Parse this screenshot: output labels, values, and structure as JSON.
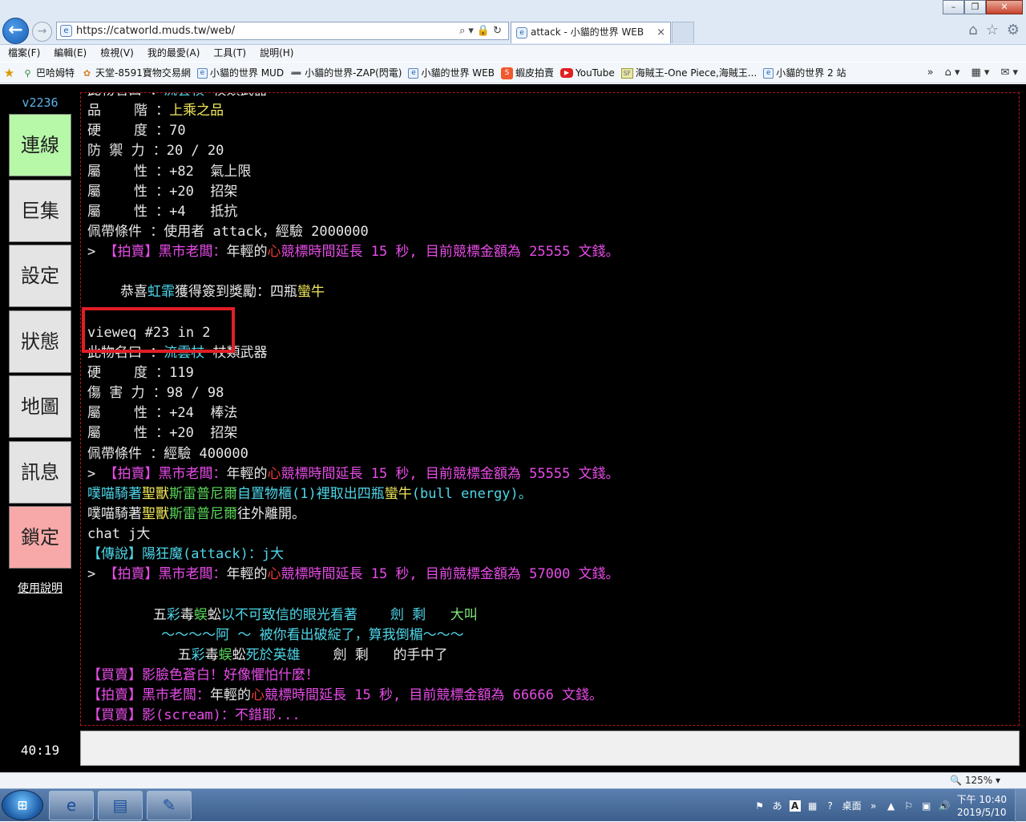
{
  "browser": {
    "url": "https://catworld.muds.tw/web/",
    "tab_title": "attack - 小貓的世界 WEB",
    "tab_close": "×",
    "menu": [
      "檔案(F)",
      "編輯(E)",
      "檢視(V)",
      "我的最愛(A)",
      "工具(T)",
      "說明(H)"
    ],
    "favorites": [
      {
        "label": "巴哈姆特",
        "icon": "bird-icon"
      },
      {
        "label": "天堂-8591寶物交易網",
        "icon": "gift-icon"
      },
      {
        "label": "小貓的世界 MUD",
        "icon": "page-icon"
      },
      {
        "label": "小貓的世界-ZAP(閃電)",
        "icon": "zap-icon"
      },
      {
        "label": "小貓的世界 WEB",
        "icon": "page-icon"
      },
      {
        "label": "蝦皮拍賣",
        "icon": "shopee-icon"
      },
      {
        "label": "YouTube",
        "icon": "youtube-icon"
      },
      {
        "label": "海賊王-One Piece,海賊王...",
        "icon": "sf-icon"
      },
      {
        "label": "小貓的世界 2 站",
        "icon": "page-icon"
      }
    ],
    "zoom": "125%"
  },
  "sidebar": {
    "version": "v2236",
    "buttons": [
      {
        "label": "連線",
        "style": "green"
      },
      {
        "label": "巨集",
        "style": "gray"
      },
      {
        "label": "設定",
        "style": "gray"
      },
      {
        "label": "狀態",
        "style": "gray"
      },
      {
        "label": "地圖",
        "style": "gray"
      },
      {
        "label": "訊息",
        "style": "gray"
      },
      {
        "label": "鎖定",
        "style": "pink"
      }
    ],
    "help_link": "使用說明",
    "timer": "40:19"
  },
  "terminal": {
    "highlight_color": "#e01e26",
    "lines": [
      [
        {
          "t": "此物名曰 ：",
          "c": "w"
        },
        {
          "t": "流雲杖",
          "c": "c"
        },
        {
          "t": " 杖類武器",
          "c": "w"
        }
      ],
      [
        {
          "t": "品    階 ：",
          "c": "w"
        },
        {
          "t": "上乘之品",
          "c": "y"
        }
      ],
      [
        {
          "t": "硬    度 ：70",
          "c": "w"
        }
      ],
      [
        {
          "t": "防 禦 力 ：20 / 20",
          "c": "w"
        }
      ],
      [
        {
          "t": "屬    性 ：+82  氣上限",
          "c": "w"
        }
      ],
      [
        {
          "t": "屬    性 ：+20  招架",
          "c": "w"
        }
      ],
      [
        {
          "t": "屬    性 ：+4   抵抗",
          "c": "w"
        }
      ],
      [
        {
          "t": "佩帶條件 ：使用者 attack，經驗 2000000",
          "c": "w"
        }
      ],
      [
        {
          "t": "> ",
          "c": "w"
        },
        {
          "t": "【拍賣】黑市老闆：",
          "c": "m"
        },
        {
          "t": "年輕的",
          "c": "w"
        },
        {
          "t": "心",
          "c": "r"
        },
        {
          "t": "競標時間延長 15 秒, 目前競標金額為 25555 文錢。",
          "c": "m"
        }
      ],
      [
        {
          "t": "",
          "c": "w"
        }
      ],
      [
        {
          "t": "    恭喜",
          "c": "w"
        },
        {
          "t": "虹霏",
          "c": "c"
        },
        {
          "t": "獲得簽到獎勵：四瓶",
          "c": "w"
        },
        {
          "t": "蠻牛",
          "c": "y"
        }
      ],
      [
        {
          "t": "",
          "c": "w"
        }
      ],
      [
        {
          "t": "vieweq #23 in 2",
          "c": "w"
        }
      ],
      [
        {
          "t": "此物名曰 ：",
          "c": "w"
        },
        {
          "t": "流雲杖",
          "c": "c"
        },
        {
          "t": " 杖類武器",
          "c": "w"
        }
      ],
      [
        {
          "t": "硬    度 ：119",
          "c": "w"
        }
      ],
      [
        {
          "t": "傷 害 力 ：98 / 98",
          "c": "w"
        }
      ],
      [
        {
          "t": "屬    性 ：+24  棒法",
          "c": "w"
        }
      ],
      [
        {
          "t": "屬    性 ：+20  招架",
          "c": "w"
        }
      ],
      [
        {
          "t": "佩帶條件 ：經驗 400000",
          "c": "w"
        }
      ],
      [
        {
          "t": "> ",
          "c": "w"
        },
        {
          "t": "【拍賣】黑市老闆：",
          "c": "m"
        },
        {
          "t": "年輕的",
          "c": "w"
        },
        {
          "t": "心",
          "c": "r"
        },
        {
          "t": "競標時間延長 15 秒, 目前競標金額為 55555 文錢。",
          "c": "m"
        }
      ],
      [
        {
          "t": "噗喵騎著",
          "c": "c"
        },
        {
          "t": "聖獸",
          "c": "y"
        },
        {
          "t": "斯雷普尼爾",
          "c": "g"
        },
        {
          "t": "自置物櫃(1)裡取出四瓶",
          "c": "c"
        },
        {
          "t": "蠻牛",
          "c": "y"
        },
        {
          "t": "(bull energy)。",
          "c": "c"
        }
      ],
      [
        {
          "t": "噗喵騎著",
          "c": "w"
        },
        {
          "t": "聖獸",
          "c": "y"
        },
        {
          "t": "斯雷普尼爾",
          "c": "g"
        },
        {
          "t": "往外離開。",
          "c": "w"
        }
      ],
      [
        {
          "t": "chat j大",
          "c": "w"
        }
      ],
      [
        {
          "t": "【傳說】陽狂魔(attack)：j大",
          "c": "c"
        }
      ],
      [
        {
          "t": "> ",
          "c": "w"
        },
        {
          "t": "【拍賣】黑市老闆：",
          "c": "m"
        },
        {
          "t": "年輕的",
          "c": "w"
        },
        {
          "t": "心",
          "c": "r"
        },
        {
          "t": "競標時間延長 15 秒, 目前競標金額為 57000 文錢。",
          "c": "m"
        }
      ],
      [
        {
          "t": "",
          "c": "w"
        }
      ],
      [
        {
          "t": "        五",
          "c": "w"
        },
        {
          "t": "彩",
          "c": "c"
        },
        {
          "t": "毒",
          "c": "w"
        },
        {
          "t": "蜈",
          "c": "g"
        },
        {
          "t": "蚣",
          "c": "w"
        },
        {
          "t": "以不可致信的眼光看著    劍 剩   ",
          "c": "c"
        },
        {
          "t": "大叫",
          "c": "lg"
        }
      ],
      [
        {
          "t": "         ～～～～阿 ～ 被你看出破綻了，算我倒楣～～～",
          "c": "c"
        }
      ],
      [
        {
          "t": "           五",
          "c": "w"
        },
        {
          "t": "彩",
          "c": "c"
        },
        {
          "t": "毒",
          "c": "w"
        },
        {
          "t": "蜈",
          "c": "g"
        },
        {
          "t": "蚣",
          "c": "w"
        },
        {
          "t": "死於英雄",
          "c": "c"
        },
        {
          "t": "    劍 剩   的手中了",
          "c": "w"
        }
      ],
      [
        {
          "t": "【買賣】影臉色蒼白！好像懼怕什麼！",
          "c": "m"
        }
      ],
      [
        {
          "t": "【拍賣】黑市老闆：",
          "c": "m"
        },
        {
          "t": "年輕的",
          "c": "w"
        },
        {
          "t": "心",
          "c": "r"
        },
        {
          "t": "競標時間延長 15 秒, 目前競標金額為 66666 文錢。",
          "c": "m"
        }
      ],
      [
        {
          "t": "【買賣】影(scream)：不錯耶...",
          "c": "m"
        }
      ]
    ]
  },
  "taskbar": {
    "start_label": "⊞",
    "desktop_label": "桌面",
    "time": "下午 10:40",
    "date": "2019/5/10"
  }
}
